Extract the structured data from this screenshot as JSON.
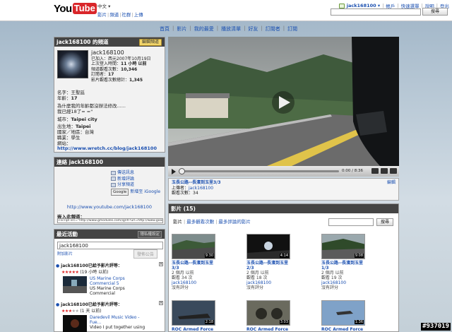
{
  "header": {
    "logo_you": "You",
    "logo_tube": "Tube",
    "language": "中文 ▾",
    "nav": [
      "影片",
      "頻道",
      "社群",
      "上傳"
    ],
    "username": "jack168100 ▾",
    "account_links": [
      "帳戶",
      "快速選單",
      "說明",
      "登出"
    ],
    "search_button": "搜尋"
  },
  "channel_nav": [
    "首頁",
    "影片",
    "我的最愛",
    "播放清單",
    "好友",
    "訂閱者",
    "訂閱"
  ],
  "profile": {
    "header": "jack168100 的頻道",
    "edit_button": "編輯頻道",
    "username": "jack168100",
    "joined": "已加入：西元2007年10月19日",
    "last_login_label": "上次登入時間：",
    "last_login_value": "11 小時 以前",
    "views_label": "頻道觀看次數：",
    "views_value": "10,346",
    "subscribers_label": "訂閱者：",
    "subscribers_value": "17",
    "video_views_label": "影片觀看次數總計：",
    "video_views_value": "1,345",
    "name": "名字：王聖廷",
    "age_label": "年齡：",
    "age_value": "17",
    "bio_line1": "為什麼我的年齡都沒辦法修改......",
    "bio_line2": "我已經18了= =\"",
    "city_label": "城市：",
    "city_value": "Taipei city",
    "birthplace_label": "出生地：",
    "birthplace_value": "Taipei",
    "country": "國家／地區：台灣",
    "job": "職業：學生",
    "website_label": "網站：",
    "website": "http://www.wretch.cc/blog/jack168100"
  },
  "connect": {
    "header": "連絡 jack168100",
    "links": [
      "傳送訊息",
      "新增評論",
      "分享頻道"
    ],
    "add_google": "Google",
    "add_igoogle": "新增至 iGoogle",
    "channel_url": "http://www.youtube.com/jack168100",
    "embed_label": "嵌入此頻道：",
    "embed_code": "<script src=\"http://www.gmodules.com/ig/ifr?url=http://www.google.com/ig/modules/youtube.xml"
  },
  "activity": {
    "header": "最近活動",
    "settings_button": "隱私權設定",
    "input_value": "jack168100",
    "add_link": "附加影片",
    "post_button": "發佈公告",
    "items": [
      {
        "title": "jack168100已給予影片評等：",
        "stars": 5,
        "time": "(19 小時 以前)",
        "video_title1": "US Marine Corps",
        "video_title2": "Commercial 5",
        "video_title3": "US Marine Corps",
        "video_title4": "Commercial"
      },
      {
        "title": "jack168100已給予影片評等：",
        "stars": 3,
        "time": "(1 天 以前)",
        "video_title1": "Daredevil Music Video -",
        "video_title2": "Fue...",
        "video_title3": "Video I put together using",
        "video_title4": ""
      }
    ]
  },
  "player": {
    "time": "0:00 / 8:36",
    "video_title": "玉長公路--長濱到玉里3/3",
    "uploader_label": "上傳者：",
    "uploader": "jack168100",
    "views": "觀看次數：34",
    "rate_link": "編輯"
  },
  "videos": {
    "header": "影片 (15)",
    "tabs": [
      "影片",
      "最多觀看次數",
      "最多評論的影片"
    ],
    "search_button": "搜尋",
    "items": [
      {
        "duration": "9:30",
        "title1": "玉長公路--長濱到玉里",
        "title2": "3/3",
        "age": "2 個月 以前",
        "views": "觀看 34 次",
        "user": "jack168100",
        "rating": "沒有評分"
      },
      {
        "duration": "4:14",
        "title1": "玉長公路--長濱到玉里",
        "title2": "2/3",
        "age": "2 個月 以前",
        "views": "觀看 18 次",
        "user": "jack168100",
        "rating": "沒有評分"
      },
      {
        "duration": "9:08",
        "title1": "玉長公路--長濱到玉里",
        "title2": "1/3",
        "age": "2 個月 以前",
        "views": "觀看 19 次",
        "user": "jack168100",
        "rating": "沒有評分"
      },
      {
        "duration": "2:18",
        "title1": "ROC Armed Force",
        "title2": "",
        "age": "",
        "views": "",
        "user": "",
        "rating": ""
      },
      {
        "duration": "3:03",
        "title1": "ROC Armed Force",
        "title2": "",
        "age": "",
        "views": "",
        "user": "",
        "rating": ""
      },
      {
        "duration": "1:36",
        "title1": "ROC Armed Force",
        "title2": "",
        "age": "",
        "views": "",
        "user": "",
        "rating": ""
      }
    ]
  },
  "watermark": "#937019"
}
